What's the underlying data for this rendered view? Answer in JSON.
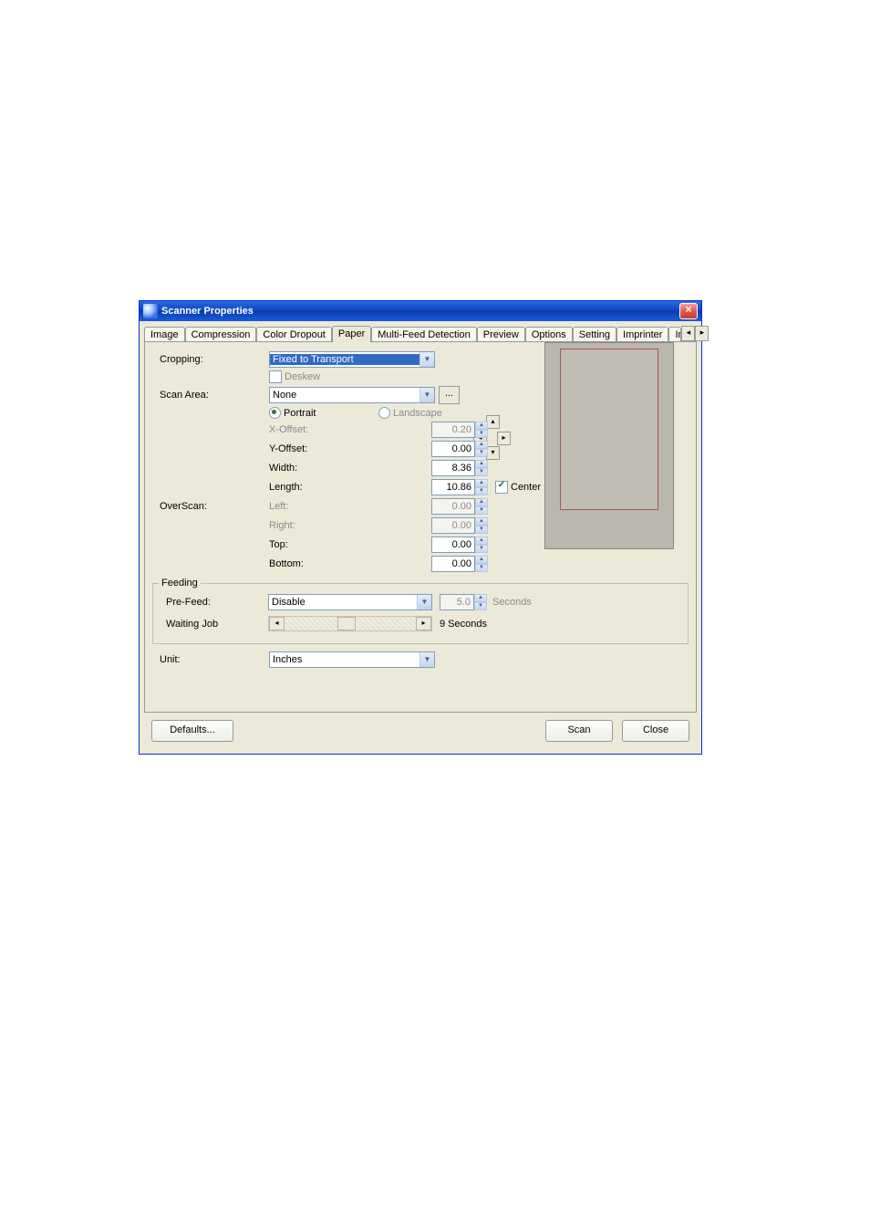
{
  "window": {
    "title": "Scanner Properties",
    "close": "×"
  },
  "tabs": {
    "items": [
      "Image",
      "Compression",
      "Color Dropout",
      "Paper",
      "Multi-Feed Detection",
      "Preview",
      "Options",
      "Setting",
      "Imprinter",
      "In"
    ],
    "active_index": 3,
    "nav_left": "◂",
    "nav_right": "▸"
  },
  "paper": {
    "cropping_label": "Cropping:",
    "cropping_value": "Fixed to Transport",
    "deskew_label": "Deskew",
    "scan_area_label": "Scan Area:",
    "scan_area_value": "None",
    "scan_area_more": "...",
    "orientation": {
      "portrait_label": "Portrait",
      "landscape_label": "Landscape",
      "selected": "portrait"
    },
    "x_offset_label": "X-Offset:",
    "x_offset_value": "0.20",
    "y_offset_label": "Y-Offset:",
    "y_offset_value": "0.00",
    "width_label": "Width:",
    "width_value": "8.36",
    "length_label": "Length:",
    "length_value": "10.86",
    "center_label": "Center"
  },
  "overscan": {
    "label": "OverScan:",
    "left_label": "Left:",
    "left_value": "0.00",
    "right_label": "Right:",
    "right_value": "0.00",
    "top_label": "Top:",
    "top_value": "0.00",
    "bottom_label": "Bottom:",
    "bottom_value": "0.00"
  },
  "feeding": {
    "legend": "Feeding",
    "prefeed_label": "Pre-Feed:",
    "prefeed_value": "Disable",
    "prefeed_seconds_value": "5.0",
    "prefeed_seconds_label": "Seconds",
    "waiting_job_label": "Waiting Job",
    "waiting_job_value": "9 Seconds"
  },
  "unit": {
    "label": "Unit:",
    "value": "Inches"
  },
  "buttons": {
    "defaults": "Defaults...",
    "scan": "Scan",
    "close": "Close"
  },
  "arrows": {
    "up": "▴",
    "down": "▾",
    "left": "◂",
    "right": "▸"
  }
}
